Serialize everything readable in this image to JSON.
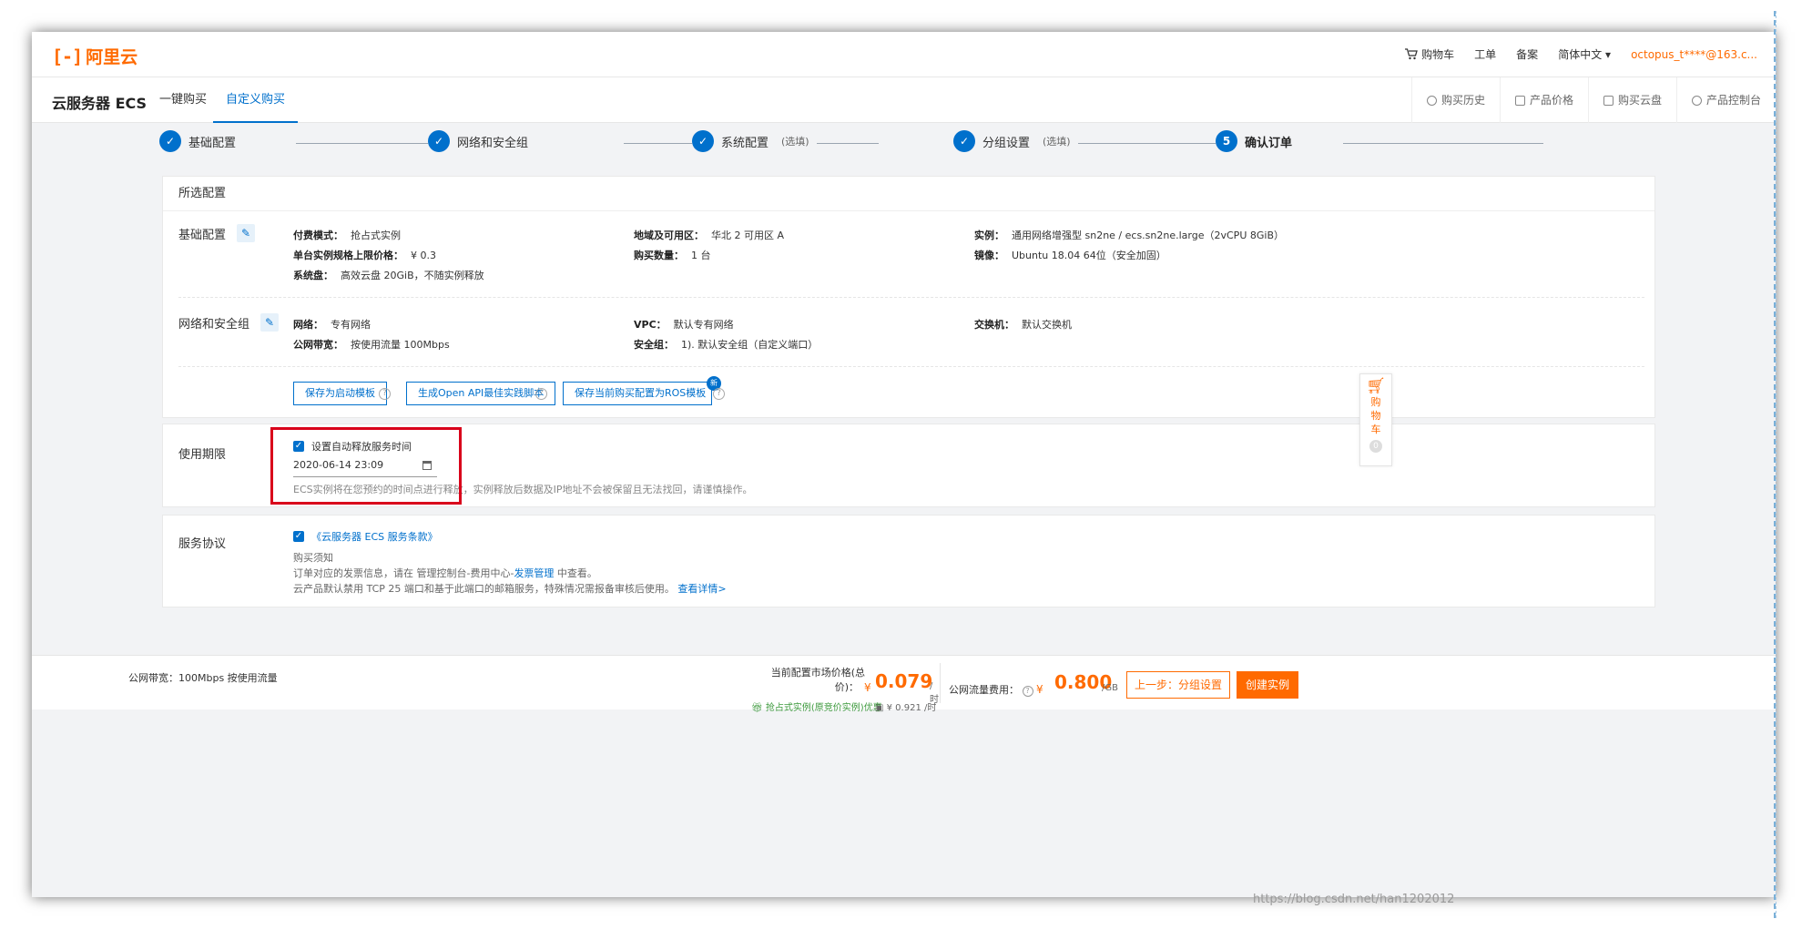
{
  "brand": {
    "mark": "[-]",
    "name": "阿里云"
  },
  "topnav": {
    "cart": "购物车",
    "ticket": "工单",
    "record": "备案",
    "language": "简体中文",
    "user": "octopus_t****@163.c..."
  },
  "subnav": {
    "product_title": "云服务器 ECS",
    "tabs": [
      "一键购买",
      "自定义购买"
    ],
    "links": [
      "购买历史",
      "产品价格",
      "购买云盘",
      "产品控制台"
    ]
  },
  "steps": [
    {
      "num": "✓",
      "label": "基础配置",
      "optional": ""
    },
    {
      "num": "✓",
      "label": "网络和安全组",
      "optional": ""
    },
    {
      "num": "✓",
      "label": "系统配置",
      "optional": "(选填)"
    },
    {
      "num": "✓",
      "label": "分组设置",
      "optional": "(选填)"
    },
    {
      "num": "5",
      "label": "确认订单",
      "optional": ""
    }
  ],
  "selected": {
    "header": "所选配置",
    "basic": {
      "label": "基础配置",
      "pay_mode_k": "付费模式：",
      "pay_mode_v": "抢占式实例",
      "region_k": "地域及可用区：",
      "region_v": "华北 2 可用区 A",
      "instance_k": "实例：",
      "instance_v": "通用网络增强型 sn2ne / ecs.sn2ne.large（2vCPU 8GiB）",
      "max_price_k": "单台实例规格上限价格：",
      "max_price_v": "¥ 0.3",
      "qty_k": "购买数量：",
      "qty_v": "1 台",
      "image_k": "镜像：",
      "image_v": "Ubuntu 18.04 64位（安全加固）",
      "disk_k": "系统盘：",
      "disk_v": "高效云盘 20GiB，不随实例释放"
    },
    "network": {
      "label": "网络和安全组",
      "net_k": "网络：",
      "net_v": "专有网络",
      "vpc_k": "VPC：",
      "vpc_v": "默认专有网络",
      "switch_k": "交换机：",
      "switch_v": "默认交换机",
      "bw_k": "公网带宽：",
      "bw_v": "按使用流量 100Mbps",
      "sg_k": "安全组：",
      "sg_v": "1). 默认安全组（自定义端口）"
    },
    "buttons": [
      "保存为启动模板",
      "生成Open API最佳实践脚本",
      "保存当前购买配置为ROS模板"
    ],
    "new_badge": "新"
  },
  "usage": {
    "label": "使用期限",
    "checkbox_label": "设置自动释放服务时间",
    "datetime": "2020-06-14 23:09",
    "hint": "ECS实例将在您预约的时间点进行释放，实例释放后数据及IP地址不会被保留且无法找回，请谨慎操作。"
  },
  "agreement": {
    "label": "服务协议",
    "terms": "《云服务器 ECS 服务条款》",
    "purchase_notice": "购买须知",
    "line1_a": "订单对应的发票信息，请在 管理控制台-费用中心-",
    "line1_link": "发票管理",
    "line1_b": " 中查看。",
    "line2": "云产品默认禁用 TCP 25 端口和基于此端口的邮箱服务，特殊情况需报备审核后使用。",
    "line2_link": "查看详情>"
  },
  "side_cart": {
    "label_1": "购",
    "label_2": "物",
    "label_3": "车",
    "count": "0"
  },
  "footer": {
    "bandwidth": "公网带宽：100Mbps 按使用流量",
    "price_label_1": "当前配置市场价格(总",
    "price_label_2": "价)：",
    "currency": "¥",
    "price": "0.079",
    "price_unit": "/时",
    "spot_note": "抢占式实例(原竞价实例)优惠",
    "orig_price": "¥ 0.921",
    "orig_unit": "/时",
    "traffic_label": "公网流量费用：",
    "traffic_price": "0.800",
    "traffic_unit": "/GB",
    "prev_button": "上一步：分组设置",
    "create_button": "创建实例"
  },
  "watermark": "https://blog.csdn.net/han1202012",
  "colors": {
    "accent": "#0070cc",
    "brand": "#ff6a00",
    "highlight": "#d9001b"
  }
}
